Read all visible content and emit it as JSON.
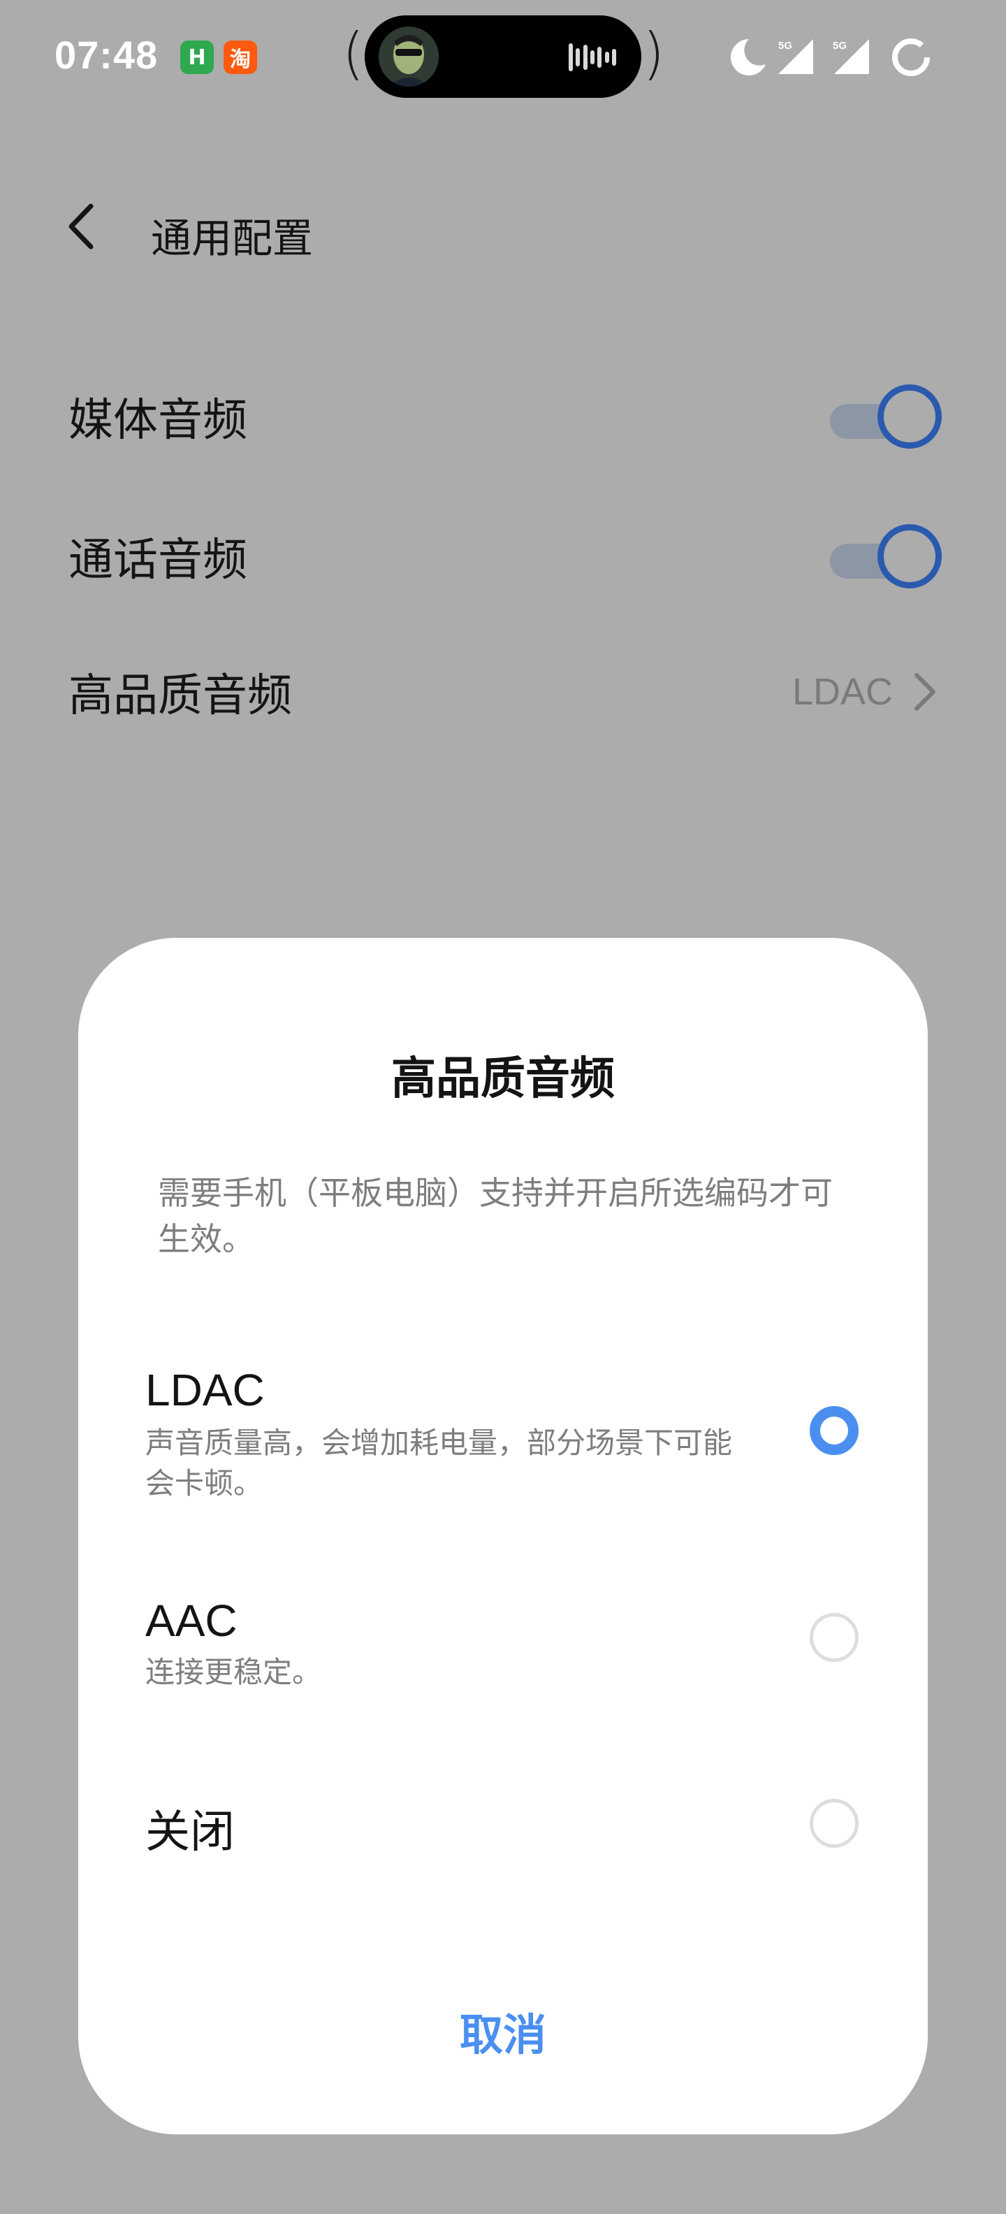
{
  "status_bar": {
    "time": "07:48",
    "app_badges": [
      {
        "name": "green-app",
        "glyph": "H",
        "color": "#2fa84f"
      },
      {
        "name": "taobao",
        "glyph": "淘",
        "color": "#ff5a0f"
      }
    ],
    "signal_1_label": "5G",
    "signal_2_label": "5G",
    "icons": [
      "moon-icon",
      "signal-icon",
      "signal-icon",
      "battery-ring-icon"
    ]
  },
  "page": {
    "title": "通用配置",
    "rows": [
      {
        "label": "媒体音频",
        "toggle_on": true
      },
      {
        "label": "通话音频",
        "toggle_on": true
      },
      {
        "label": "高品质音频",
        "value": "LDAC"
      }
    ],
    "accent_color": "#2a5aae"
  },
  "dialog": {
    "title": "高品质音频",
    "description": "需要手机（平板电脑）支持并开启所选编码才可生效。",
    "options": [
      {
        "name": "LDAC",
        "subtitle": "声音质量高，会增加耗电量，部分场景下可能会卡顿。",
        "selected": true
      },
      {
        "name": "AAC",
        "subtitle": "连接更稳定。",
        "selected": false
      },
      {
        "name": "关闭",
        "subtitle": "",
        "selected": false
      }
    ],
    "cancel_label": "取消",
    "accent_color": "#4a8ff0"
  }
}
